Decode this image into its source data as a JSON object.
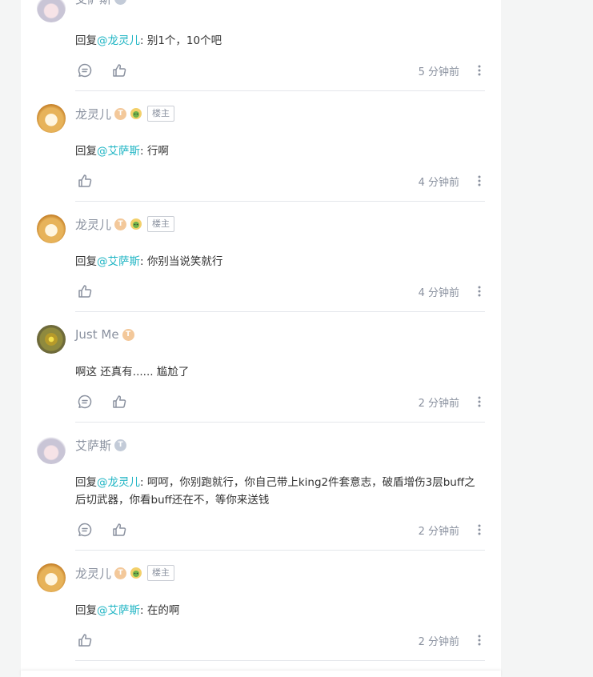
{
  "comments": [
    {
      "name": "艾萨斯",
      "level": "T",
      "reply_prefix": "回复",
      "mention": "@龙灵儿",
      "text": ": 别1个，10个吧",
      "time": "5 分钟前"
    },
    {
      "name": "龙灵儿",
      "level": "T",
      "owner_tag": "楼主",
      "reply_prefix": "回复",
      "mention": "@艾萨斯",
      "text": ": 行啊",
      "time": "4 分钟前"
    },
    {
      "name": "龙灵儿",
      "level": "T",
      "owner_tag": "楼主",
      "reply_prefix": "回复",
      "mention": "@艾萨斯",
      "text": ": 你别当说笑就行",
      "time": "4 分钟前"
    },
    {
      "name": "Just Me",
      "level": "T",
      "text": "啊这 还真有...... 尴尬了",
      "time": "2 分钟前"
    },
    {
      "name": "艾萨斯",
      "level": "T",
      "reply_prefix": "回复",
      "mention": "@龙灵儿",
      "text": ": 呵呵，你别跑就行，你自己带上king2件套意志，破盾增伤3层buff之后切武器，你看buff还在不，等你来送钱",
      "time": "2 分钟前"
    },
    {
      "name": "龙灵儿",
      "level": "T",
      "owner_tag": "楼主",
      "reply_prefix": "回复",
      "mention": "@艾萨斯",
      "text": ": 在的啊",
      "time": "2 分钟前"
    }
  ],
  "colors": {
    "mention": "#1fb5c4",
    "meta_text": "#8a919f",
    "divider": "#e4e6eb"
  },
  "icons": {
    "reply": "comment-bubble-icon",
    "like": "thumbs-up-icon",
    "more": "vertical-ellipsis-icon"
  }
}
